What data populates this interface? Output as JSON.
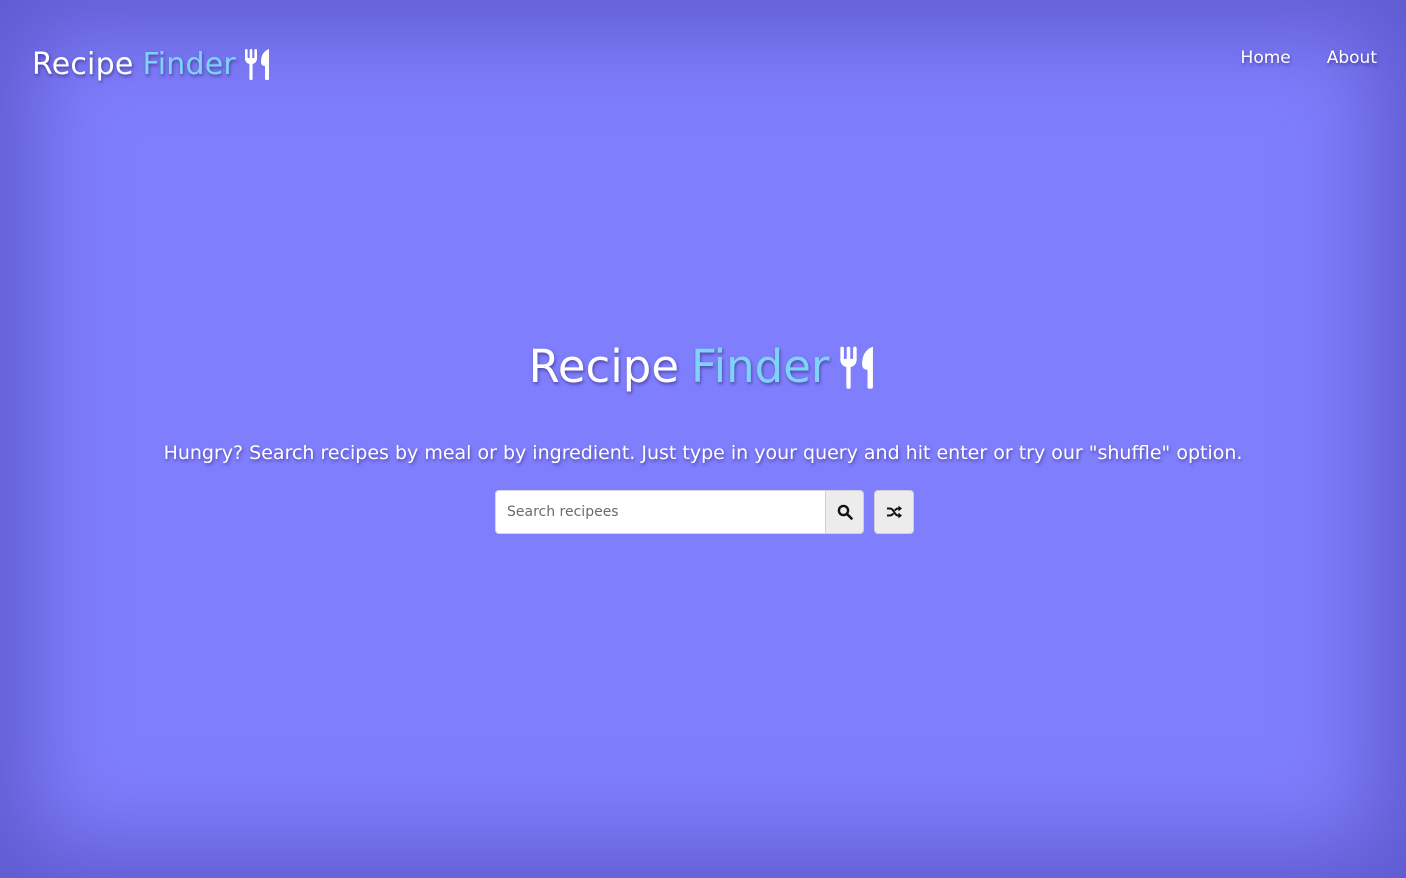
{
  "header": {
    "brand": {
      "word1": "Recipe",
      "word2": "Finder",
      "icon": "utensils-icon"
    },
    "nav": [
      {
        "label": "Home"
      },
      {
        "label": "About"
      }
    ]
  },
  "hero": {
    "title": {
      "word1": "Recipe",
      "word2": "Finder",
      "icon": "utensils-icon"
    },
    "tagline": "Hungry? Search recipes by meal or by ingredient. Just type in your query and hit enter or try our \"shuffle\" option.",
    "search": {
      "placeholder": "Search recipees",
      "value": "",
      "search_icon": "search-icon",
      "shuffle_icon": "shuffle-icon"
    }
  },
  "colors": {
    "background": "#7f7efc",
    "accent": "#7fd3f7",
    "text": "#ffffff"
  }
}
